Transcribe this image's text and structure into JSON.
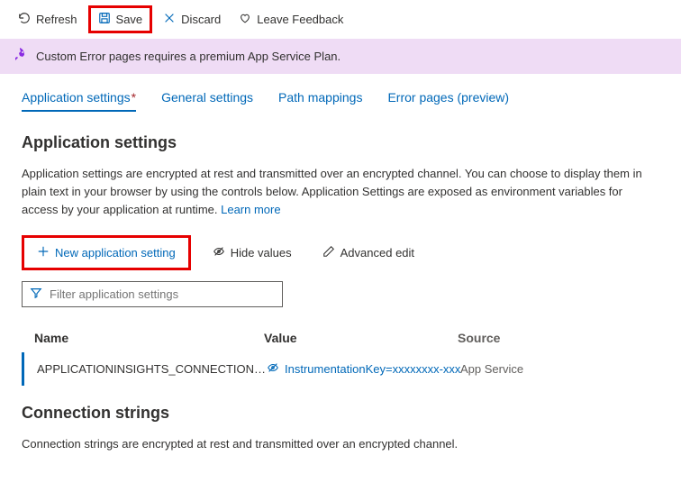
{
  "toolbar": {
    "refresh": "Refresh",
    "save": "Save",
    "discard": "Discard",
    "feedback": "Leave Feedback"
  },
  "banner": {
    "message": "Custom Error pages requires a premium App Service Plan."
  },
  "tabs": {
    "application_settings": "Application settings",
    "general_settings": "General settings",
    "path_mappings": "Path mappings",
    "error_pages": "Error pages (preview)"
  },
  "appSettings": {
    "heading": "Application settings",
    "description": "Application settings are encrypted at rest and transmitted over an encrypted channel. You can choose to display them in plain text in your browser by using the controls below. Application Settings are exposed as environment variables for access by your application at runtime. ",
    "learnMore": "Learn more",
    "actions": {
      "newSetting": "New application setting",
      "hideValues": "Hide values",
      "advancedEdit": "Advanced edit"
    },
    "filterPlaceholder": "Filter application settings",
    "columns": {
      "name": "Name",
      "value": "Value",
      "source": "Source"
    },
    "rows": [
      {
        "name": "APPLICATIONINSIGHTS_CONNECTION_STRING",
        "value": "InstrumentationKey=xxxxxxxx-xxxx-xxxx",
        "source": "App Service"
      }
    ]
  },
  "connectionStrings": {
    "heading": "Connection strings",
    "description": "Connection strings are encrypted at rest and transmitted over an encrypted channel."
  }
}
